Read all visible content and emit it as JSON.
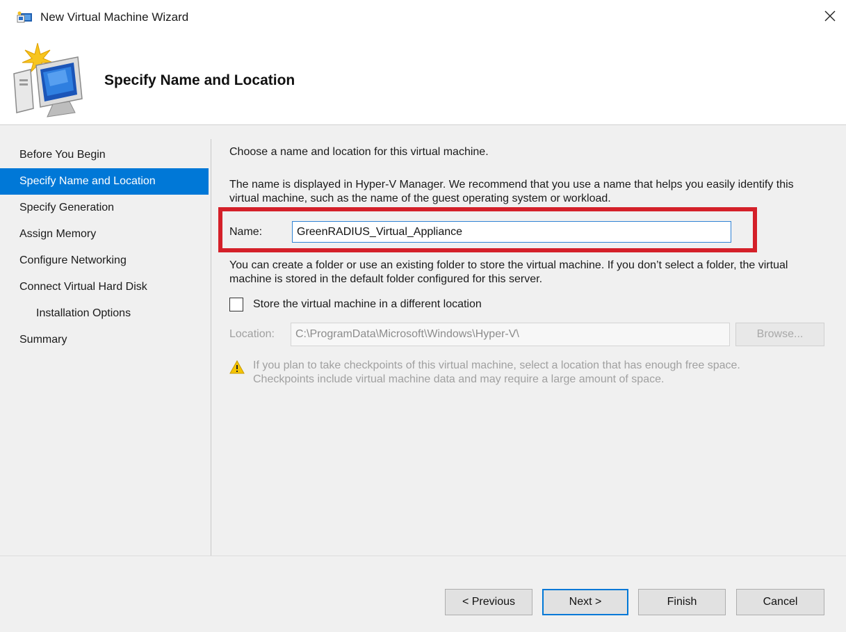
{
  "window": {
    "title": "New Virtual Machine Wizard",
    "close_glyph": "✕"
  },
  "header": {
    "title": "Specify Name and Location",
    "icon": "virtual-machine-wizard-icon"
  },
  "nav": {
    "items": [
      {
        "label": "Before You Begin",
        "selected": false,
        "indent": false
      },
      {
        "label": "Specify Name and Location",
        "selected": true,
        "indent": false
      },
      {
        "label": "Specify Generation",
        "selected": false,
        "indent": false
      },
      {
        "label": "Assign Memory",
        "selected": false,
        "indent": false
      },
      {
        "label": "Configure Networking",
        "selected": false,
        "indent": false
      },
      {
        "label": "Connect Virtual Hard Disk",
        "selected": false,
        "indent": false
      },
      {
        "label": "Installation Options",
        "selected": false,
        "indent": true
      },
      {
        "label": "Summary",
        "selected": false,
        "indent": false
      }
    ]
  },
  "content": {
    "intro": "Choose a name and location for this virtual machine.",
    "description": "The name is displayed in Hyper-V Manager. We recommend that you use a name that helps you easily identify this virtual machine, such as the name of the guest operating system or workload.",
    "name_label": "Name:",
    "name_value": "GreenRADIUS_Virtual_Appliance",
    "folder_text": "You can create a folder or use an existing folder to store the virtual machine. If you don’t select a folder, the virtual machine is stored in the default folder configured for this server.",
    "checkbox_label": "Store the virtual machine in a different location",
    "checkbox_checked": false,
    "location_label": "Location:",
    "location_value": "C:\\ProgramData\\Microsoft\\Windows\\Hyper-V\\",
    "browse_label": "Browse...",
    "warning_text": "If you plan to take checkpoints of this virtual machine, select a location that has enough free space. Checkpoints include virtual machine data and may require a large amount of space."
  },
  "buttons": {
    "previous": "< Previous",
    "next": "Next >",
    "finish": "Finish",
    "cancel": "Cancel"
  },
  "colors": {
    "accent": "#0078d7",
    "highlight": "#d42029",
    "body_bg": "#f0f0f0"
  }
}
